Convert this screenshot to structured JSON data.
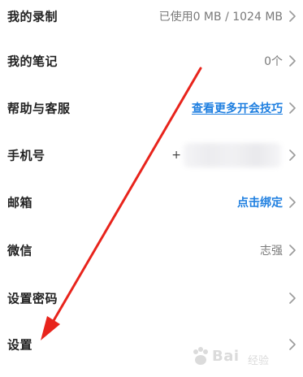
{
  "settings": {
    "rows": [
      {
        "label": "我的录制",
        "value": "已使用0 MB / 1024 MB"
      },
      {
        "label": "我的笔记",
        "value": "0个"
      },
      {
        "label": "帮助与客服",
        "value": "查看更多开会技巧"
      },
      {
        "label": "手机号",
        "value": "+"
      },
      {
        "label": "邮箱",
        "value": "点击绑定"
      },
      {
        "label": "微信",
        "value": "志强"
      },
      {
        "label": "设置密码",
        "value": ""
      },
      {
        "label": "设置",
        "value": ""
      }
    ]
  },
  "watermark": {
    "text": "Bai",
    "sub": "经验"
  },
  "annotation": {
    "type": "red-arrow",
    "color": "#e8241c",
    "points_to": "设置"
  },
  "colors": {
    "label": "#222222",
    "value": "#7a7a7a",
    "link": "#1f7fe0",
    "chevron": "#9a9a9a"
  }
}
